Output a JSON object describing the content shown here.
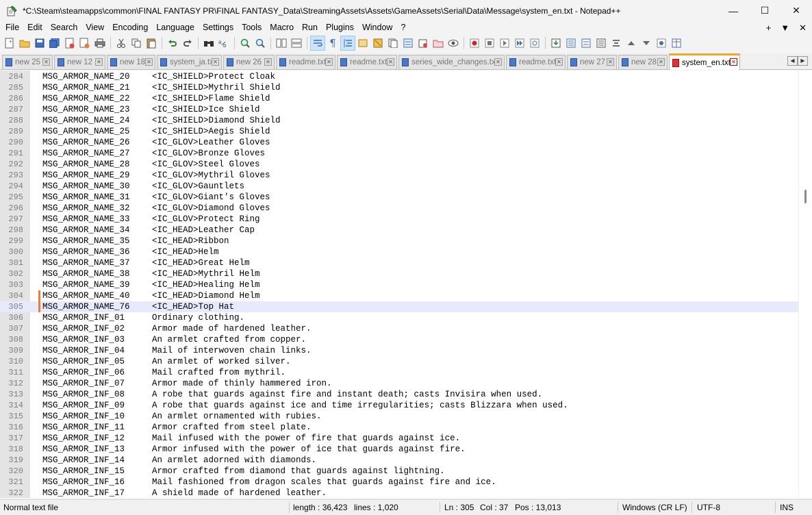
{
  "window": {
    "title": "*C:\\Steam\\steamapps\\common\\FINAL FANTASY PR\\FINAL FANTASY_Data\\StreamingAssets\\Assets\\GameAssets\\Serial\\Data\\Message\\system_en.txt - Notepad++",
    "minimize": "—",
    "maximize": "☐",
    "close": "✕"
  },
  "menu": {
    "items": [
      "File",
      "Edit",
      "Search",
      "View",
      "Encoding",
      "Language",
      "Settings",
      "Tools",
      "Macro",
      "Run",
      "Plugins",
      "Window",
      "?"
    ],
    "right": [
      "+",
      "▼",
      "✕"
    ]
  },
  "tabs": [
    {
      "label": "new 25"
    },
    {
      "label": "new 12"
    },
    {
      "label": "new 18"
    },
    {
      "label": "system_ja.txt"
    },
    {
      "label": "new 26"
    },
    {
      "label": "readme.txt"
    },
    {
      "label": "readme.txt"
    },
    {
      "label": "series_wide_changes.txt"
    },
    {
      "label": "readme.txt"
    },
    {
      "label": "new 27"
    },
    {
      "label": "new 28"
    },
    {
      "label": "system_en.txt"
    }
  ],
  "editor": {
    "current_line": 305,
    "lines": [
      {
        "n": "284",
        "k": "MSG_ARMOR_NAME_20",
        "v": "<IC_SHIELD>Protect Cloak"
      },
      {
        "n": "285",
        "k": "MSG_ARMOR_NAME_21",
        "v": "<IC_SHIELD>Mythril Shield"
      },
      {
        "n": "286",
        "k": "MSG_ARMOR_NAME_22",
        "v": "<IC_SHIELD>Flame Shield"
      },
      {
        "n": "287",
        "k": "MSG_ARMOR_NAME_23",
        "v": "<IC_SHIELD>Ice Shield"
      },
      {
        "n": "288",
        "k": "MSG_ARMOR_NAME_24",
        "v": "<IC_SHIELD>Diamond Shield"
      },
      {
        "n": "289",
        "k": "MSG_ARMOR_NAME_25",
        "v": "<IC_SHIELD>Aegis Shield"
      },
      {
        "n": "290",
        "k": "MSG_ARMOR_NAME_26",
        "v": "<IC_GLOV>Leather Gloves"
      },
      {
        "n": "291",
        "k": "MSG_ARMOR_NAME_27",
        "v": "<IC_GLOV>Bronze Gloves"
      },
      {
        "n": "292",
        "k": "MSG_ARMOR_NAME_28",
        "v": "<IC_GLOV>Steel Gloves"
      },
      {
        "n": "293",
        "k": "MSG_ARMOR_NAME_29",
        "v": "<IC_GLOV>Mythril Gloves"
      },
      {
        "n": "294",
        "k": "MSG_ARMOR_NAME_30",
        "v": "<IC_GLOV>Gauntlets"
      },
      {
        "n": "295",
        "k": "MSG_ARMOR_NAME_31",
        "v": "<IC_GLOV>Giant's Gloves"
      },
      {
        "n": "296",
        "k": "MSG_ARMOR_NAME_32",
        "v": "<IC_GLOV>Diamond Gloves"
      },
      {
        "n": "297",
        "k": "MSG_ARMOR_NAME_33",
        "v": "<IC_GLOV>Protect Ring"
      },
      {
        "n": "298",
        "k": "MSG_ARMOR_NAME_34",
        "v": "<IC_HEAD>Leather Cap"
      },
      {
        "n": "299",
        "k": "MSG_ARMOR_NAME_35",
        "v": "<IC_HEAD>Ribbon"
      },
      {
        "n": "300",
        "k": "MSG_ARMOR_NAME_36",
        "v": "<IC_HEAD>Helm"
      },
      {
        "n": "301",
        "k": "MSG_ARMOR_NAME_37",
        "v": "<IC_HEAD>Great Helm"
      },
      {
        "n": "302",
        "k": "MSG_ARMOR_NAME_38",
        "v": "<IC_HEAD>Mythril Helm"
      },
      {
        "n": "303",
        "k": "MSG_ARMOR_NAME_39",
        "v": "<IC_HEAD>Healing Helm"
      },
      {
        "n": "304",
        "k": "MSG_ARMOR_NAME_40",
        "v": "<IC_HEAD>Diamond Helm"
      },
      {
        "n": "305",
        "k": "MSG_ARMOR_NAME_76",
        "v": "<IC_HEAD>Top Hat"
      },
      {
        "n": "306",
        "k": "MSG_ARMOR_INF_01",
        "v": "Ordinary clothing."
      },
      {
        "n": "307",
        "k": "MSG_ARMOR_INF_02",
        "v": "Armor made of hardened leather."
      },
      {
        "n": "308",
        "k": "MSG_ARMOR_INF_03",
        "v": "An armlet crafted from copper."
      },
      {
        "n": "309",
        "k": "MSG_ARMOR_INF_04",
        "v": "Mail of interwoven chain links."
      },
      {
        "n": "310",
        "k": "MSG_ARMOR_INF_05",
        "v": "An armlet of worked silver."
      },
      {
        "n": "311",
        "k": "MSG_ARMOR_INF_06",
        "v": "Mail crafted from mythril."
      },
      {
        "n": "312",
        "k": "MSG_ARMOR_INF_07",
        "v": "Armor made of thinly hammered iron."
      },
      {
        "n": "313",
        "k": "MSG_ARMOR_INF_08",
        "v": "A robe that guards against fire and instant death; casts Invisira when used."
      },
      {
        "n": "314",
        "k": "MSG_ARMOR_INF_09",
        "v": "A robe that guards against ice and time irregularities; casts Blizzara when used."
      },
      {
        "n": "315",
        "k": "MSG_ARMOR_INF_10",
        "v": "An armlet ornamented with rubies."
      },
      {
        "n": "316",
        "k": "MSG_ARMOR_INF_11",
        "v": "Armor crafted from steel plate."
      },
      {
        "n": "317",
        "k": "MSG_ARMOR_INF_12",
        "v": "Mail infused with the power of fire that guards against ice."
      },
      {
        "n": "318",
        "k": "MSG_ARMOR_INF_13",
        "v": "Armor infused with the power of ice that guards against fire."
      },
      {
        "n": "319",
        "k": "MSG_ARMOR_INF_14",
        "v": "An armlet adorned with diamonds."
      },
      {
        "n": "320",
        "k": "MSG_ARMOR_INF_15",
        "v": "Armor crafted from diamond that guards against lightning."
      },
      {
        "n": "321",
        "k": "MSG_ARMOR_INF_16",
        "v": "Mail fashioned from dragon scales that guards against fire and ice."
      },
      {
        "n": "322",
        "k": "MSG_ARMOR_INF_17",
        "v": "A shield made of hardened leather."
      }
    ]
  },
  "status": {
    "filetype": "Normal text file",
    "length": "length : 36,423",
    "lines": "lines : 1,020",
    "ln": "Ln : 305",
    "col": "Col : 37",
    "pos": "Pos : 13,013",
    "eol": "Windows (CR LF)",
    "encoding": "UTF-8",
    "mode": "INS"
  },
  "colors": {
    "active_tab_accent": "#f5a623",
    "current_line_bg": "#e8e8ff",
    "change_marker": "#f07d2e"
  }
}
